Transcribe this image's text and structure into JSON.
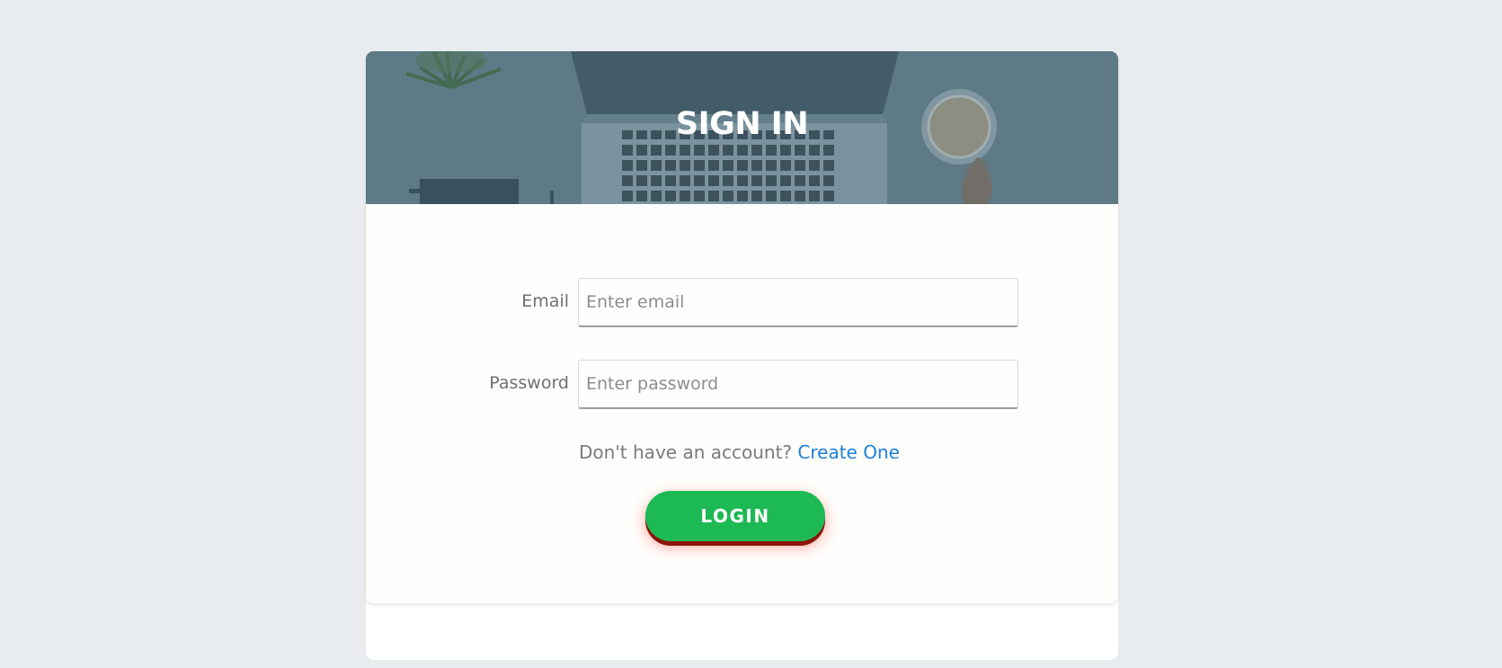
{
  "hero": {
    "title": "SIGN IN"
  },
  "form": {
    "email": {
      "label": "Email",
      "placeholder": "Enter email",
      "value": ""
    },
    "password": {
      "label": "Password",
      "placeholder": "Enter password",
      "value": ""
    },
    "signup_prompt": "Don't have an account?",
    "signup_link": "Create One",
    "login_label": "LOGIN"
  },
  "colors": {
    "page_background": "#e8ecee",
    "card_background": "#fefefc",
    "hero_tint": "#5f7a86",
    "link": "#1f7fd8",
    "login_button": "#1db954",
    "login_button_shadow": "#8b1409"
  },
  "hero_image_icons": [
    "plant-icon",
    "laptop-icon",
    "coffee-cup-icon",
    "notebook-icon"
  ]
}
